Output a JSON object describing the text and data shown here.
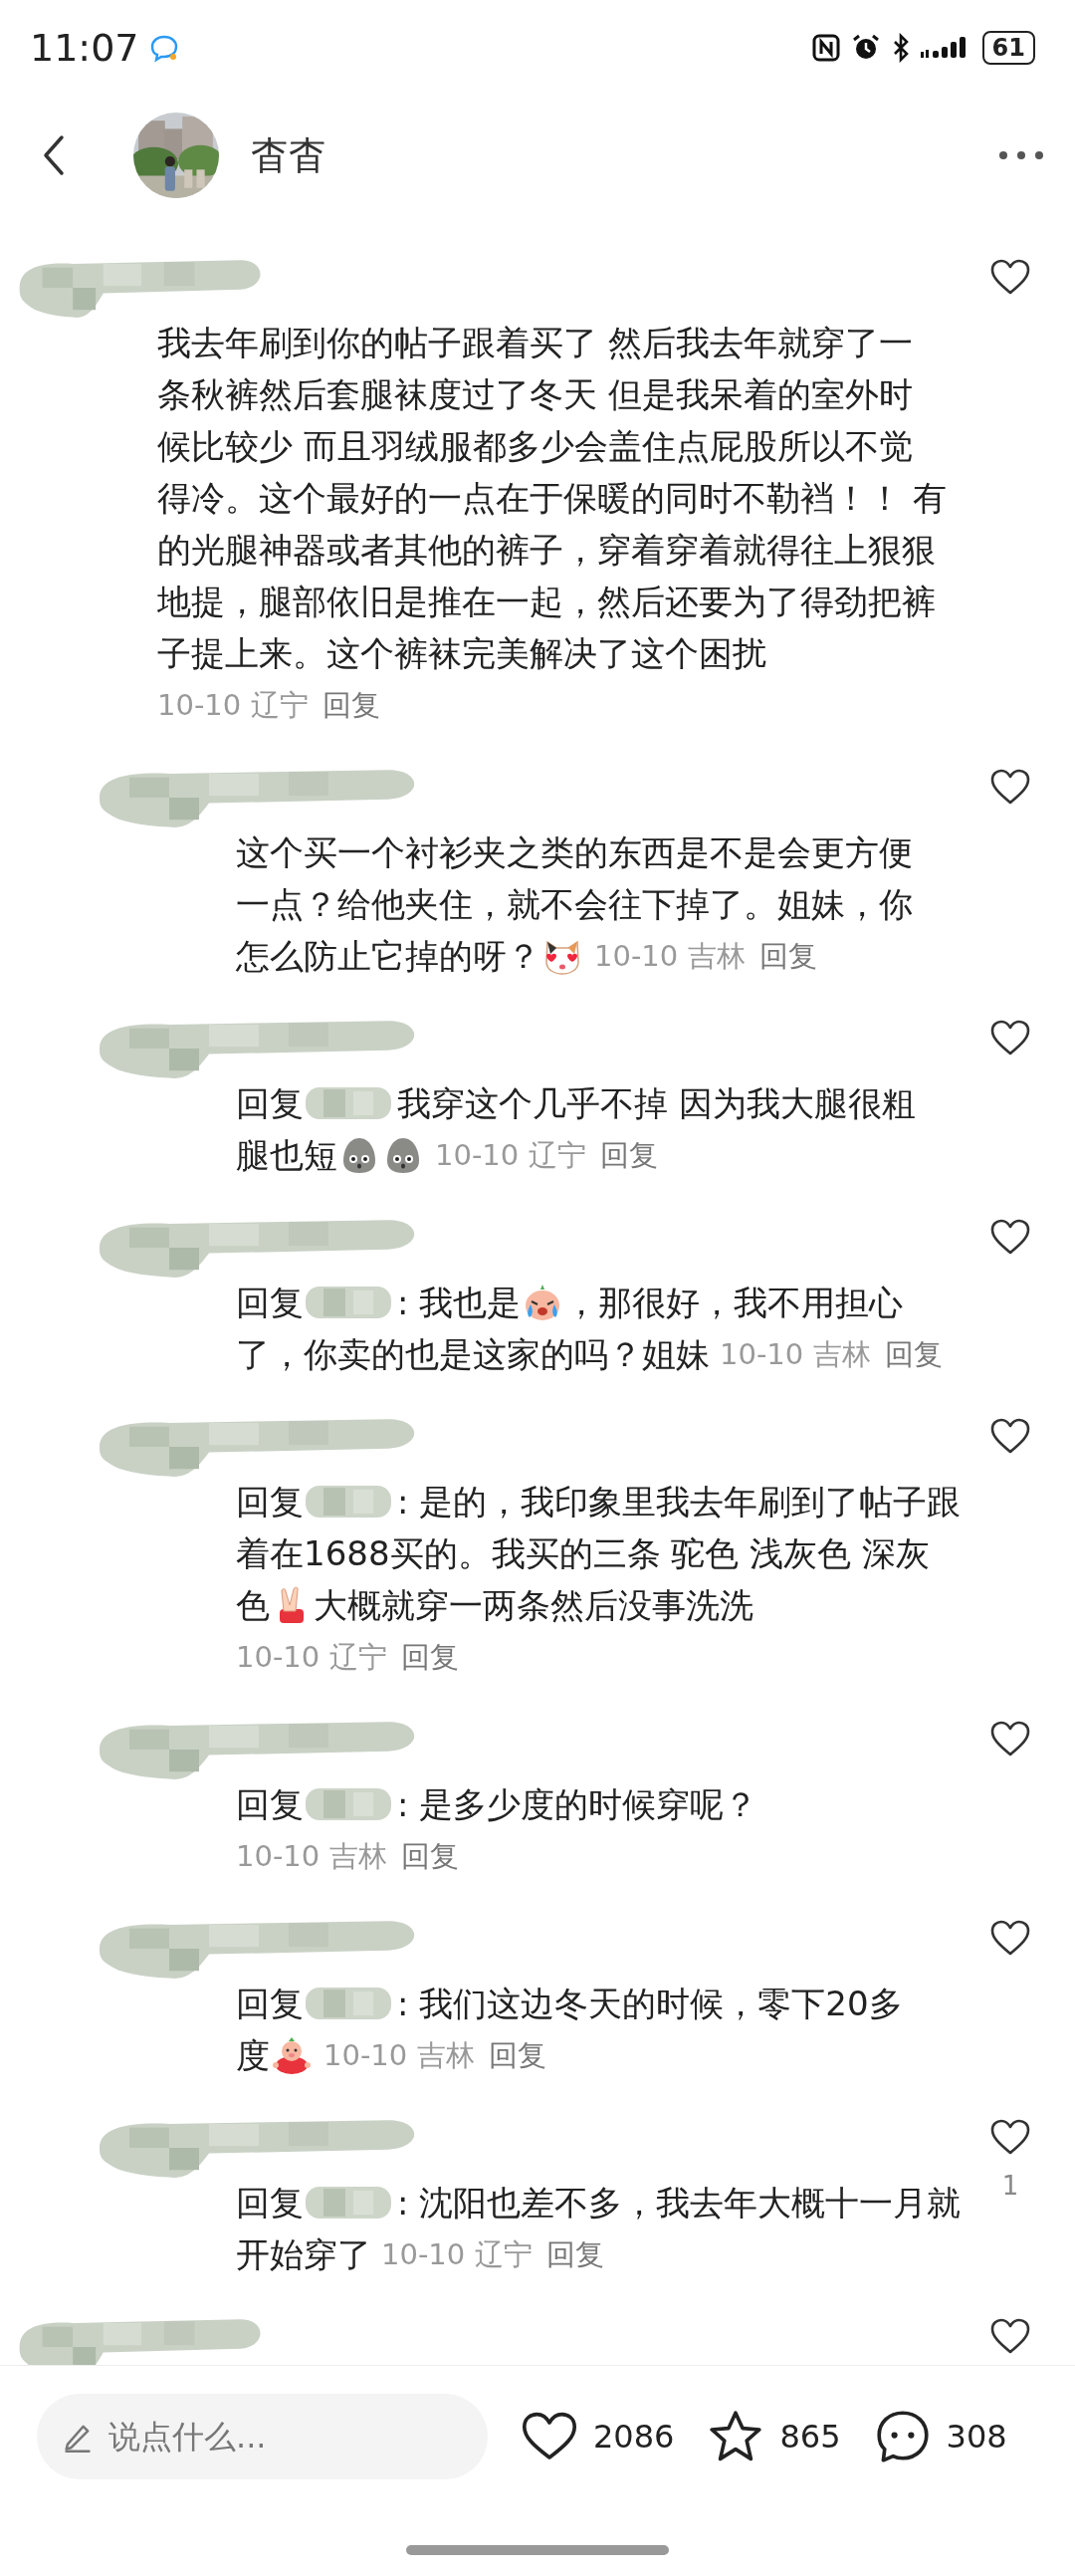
{
  "status_bar": {
    "time": "11:07",
    "battery": "61"
  },
  "header": {
    "title": "杳杳"
  },
  "comments": [
    {
      "liked": false,
      "date": "10-10",
      "region": "辽宁",
      "reply": "回复",
      "lines": [
        [
          {
            "kind": "text",
            "text": "我去年刷到你的帖子跟着买了 然后我去年就穿了一"
          }
        ],
        [
          {
            "kind": "text",
            "text": "条秋裤然后套腿袜度过了冬天 但是我呆着的室外时"
          }
        ],
        [
          {
            "kind": "text",
            "text": "候比较少 而且羽绒服都多少会盖住点屁股所以不觉"
          }
        ],
        [
          {
            "kind": "text",
            "text": "得冷。这个最好的一点在于保暖的同时不勒裆！！ 有"
          }
        ],
        [
          {
            "kind": "text",
            "text": "的光腿神器或者其他的裤子，穿着穿着就得往上狠狠"
          }
        ],
        [
          {
            "kind": "text",
            "text": "地提，腿部依旧是推在一起，然后还要为了得劲把裤"
          }
        ],
        [
          {
            "kind": "text",
            "text": "子提上来。这个裤袜完美解决了这个困扰"
          }
        ],
        [
          {
            "kind": "meta"
          }
        ]
      ],
      "replies": [
        {
          "liked": false,
          "date": "10-10",
          "region": "吉林",
          "reply": "回复",
          "lines": [
            [
              {
                "kind": "text",
                "text": "这个买一个衬衫夹之类的东西是不是会更方便"
              }
            ],
            [
              {
                "kind": "text",
                "text": "一点？给他夹住，就不会往下掉了。姐妹，你"
              }
            ],
            [
              {
                "kind": "text",
                "text": "怎么防止它掉的呀？"
              },
              {
                "kind": "cat"
              },
              {
                "kind": "meta"
              }
            ]
          ]
        },
        {
          "liked": false,
          "date": "10-10",
          "region": "辽宁",
          "reply": "回复",
          "lines": [
            [
              {
                "kind": "reply_to",
                "text": "回复"
              },
              {
                "kind": "text",
                "text": "我穿这个几乎不掉 因为我大腿很粗"
              }
            ],
            [
              {
                "kind": "text",
                "text": "腿也短"
              },
              {
                "kind": "blob"
              },
              {
                "kind": "blob"
              },
              {
                "kind": "meta"
              }
            ]
          ]
        },
        {
          "liked": false,
          "date": "10-10",
          "region": "吉林",
          "reply": "回复",
          "lines": [
            [
              {
                "kind": "reply_to",
                "text": "回复"
              },
              {
                "kind": "text",
                "text": ": 我也是"
              },
              {
                "kind": "crying"
              },
              {
                "kind": "text",
                "text": "，那很好，我不用担心"
              }
            ],
            [
              {
                "kind": "text",
                "text": "了，你卖的也是这家的吗？姐妹"
              },
              {
                "kind": "meta"
              }
            ]
          ]
        },
        {
          "liked": false,
          "date": "10-10",
          "region": "辽宁",
          "reply": "回复",
          "lines": [
            [
              {
                "kind": "reply_to",
                "text": "回复"
              },
              {
                "kind": "text",
                "text": ": 是的，我印象里我去年刷到了帖子跟"
              }
            ],
            [
              {
                "kind": "text",
                "text": "着在1688买的。我买的三条 驼色 浅灰色 深灰"
              }
            ],
            [
              {
                "kind": "text",
                "text": "色"
              },
              {
                "kind": "peace"
              },
              {
                "kind": "text",
                "text": "大概就穿一两条然后没事洗洗"
              }
            ],
            [
              {
                "kind": "meta"
              }
            ]
          ]
        },
        {
          "liked": false,
          "date": "10-10",
          "region": "吉林",
          "reply": "回复",
          "lines": [
            [
              {
                "kind": "reply_to",
                "text": "回复"
              },
              {
                "kind": "text",
                "text": ": 是多少度的时候穿呢？"
              }
            ],
            [
              {
                "kind": "meta"
              }
            ]
          ]
        },
        {
          "liked": false,
          "date": "10-10",
          "region": "吉林",
          "reply": "回复",
          "lines": [
            [
              {
                "kind": "reply_to",
                "text": "回复"
              },
              {
                "kind": "text",
                "text": ": 我们这边冬天的时候，零下20多"
              }
            ],
            [
              {
                "kind": "text",
                "text": "度"
              },
              {
                "kind": "pig"
              },
              {
                "kind": "meta"
              }
            ]
          ]
        },
        {
          "liked": false,
          "likes": "1",
          "date": "10-10",
          "region": "辽宁",
          "reply": "回复",
          "lines": [
            [
              {
                "kind": "reply_to",
                "text": "回复"
              },
              {
                "kind": "text",
                "text": ": 沈阳也差不多，我去年大概十一月就"
              }
            ],
            [
              {
                "kind": "text",
                "text": "开始穿了"
              },
              {
                "kind": "meta"
              }
            ]
          ]
        }
      ]
    },
    {
      "liked": false
    }
  ],
  "bottom_bar": {
    "placeholder": "说点什么...",
    "likes": "2086",
    "stars": "865",
    "comments": "308"
  }
}
